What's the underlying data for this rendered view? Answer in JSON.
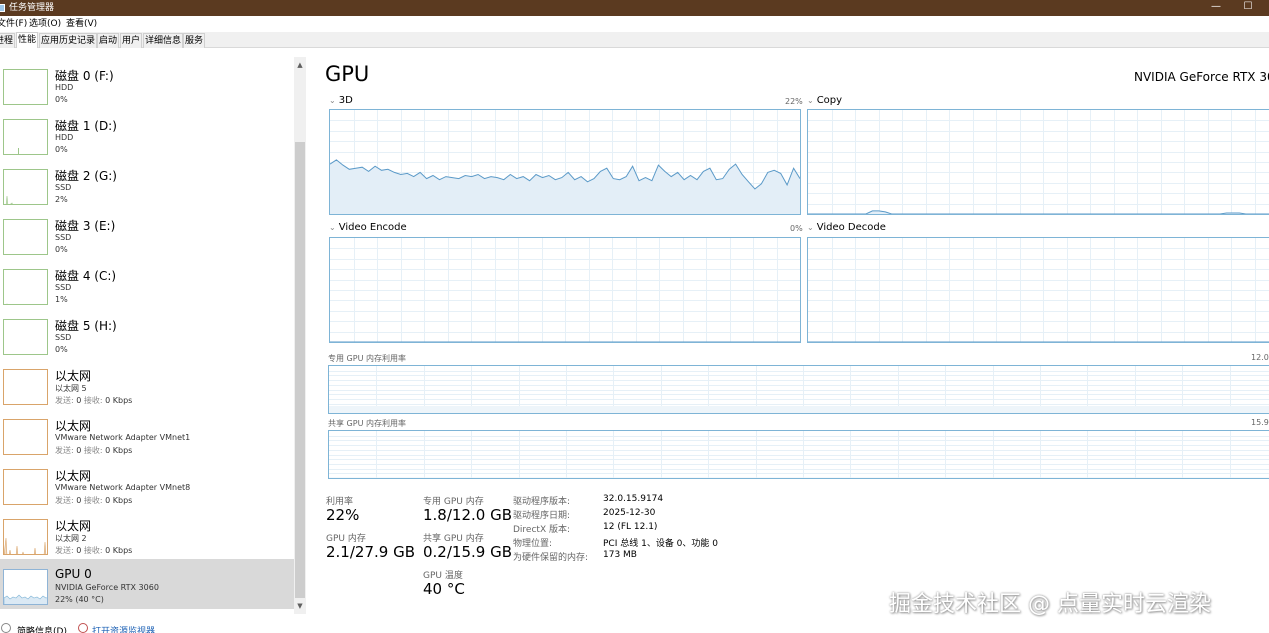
{
  "window": {
    "title": "任务管理器",
    "minimize_glyph": "—",
    "maximize_glyph": "☐"
  },
  "menu": [
    "文件(F)",
    "选项(O)",
    "查看(V)"
  ],
  "tabs": [
    "进程",
    "性能",
    "应用历史记录",
    "启动",
    "用户",
    "详细信息",
    "服务"
  ],
  "active_tab": "性能",
  "sidebar": {
    "items": [
      {
        "name": "磁盘 0 (F:)",
        "sub": "HDD",
        "value": "0%",
        "kind": "disk"
      },
      {
        "name": "磁盘 1 (D:)",
        "sub": "HDD",
        "value": "0%",
        "kind": "disk"
      },
      {
        "name": "磁盘 2 (G:)",
        "sub": "SSD",
        "value": "2%",
        "kind": "disk"
      },
      {
        "name": "磁盘 3 (E:)",
        "sub": "SSD",
        "value": "0%",
        "kind": "disk"
      },
      {
        "name": "磁盘 4 (C:)",
        "sub": "SSD",
        "value": "1%",
        "kind": "disk"
      },
      {
        "name": "磁盘 5 (H:)",
        "sub": "SSD",
        "value": "0%",
        "kind": "disk"
      },
      {
        "name": "以太网",
        "sub": "以太网 5",
        "send_label": "发送:",
        "send": "0",
        "recv_label": "接收:",
        "recv": "0 Kbps",
        "kind": "net"
      },
      {
        "name": "以太网",
        "sub": "VMware Network Adapter VMnet1",
        "send_label": "发送:",
        "send": "0",
        "recv_label": "接收:",
        "recv": "0 Kbps",
        "kind": "net"
      },
      {
        "name": "以太网",
        "sub": "VMware Network Adapter VMnet8",
        "send_label": "发送:",
        "send": "0",
        "recv_label": "接收:",
        "recv": "0 Kbps",
        "kind": "net"
      },
      {
        "name": "以太网",
        "sub": "以太网 2",
        "send_label": "发送:",
        "send": "0",
        "recv_label": "接收:",
        "recv": "0 Kbps",
        "kind": "net"
      },
      {
        "name": "GPU 0",
        "sub": "NVIDIA GeForce RTX 3060",
        "value": "22% (40 °C)",
        "kind": "gpu",
        "selected": true
      }
    ]
  },
  "main": {
    "title": "GPU",
    "gpu_name": "NVIDIA GeForce RTX 30",
    "engines": [
      {
        "label": "3D",
        "pct": "22%"
      },
      {
        "label": "Copy",
        "pct": ""
      },
      {
        "label": "Video Encode",
        "pct": "0%"
      },
      {
        "label": "Video Decode",
        "pct": ""
      }
    ],
    "dedicated_mem_label": "专用 GPU 内存利用率",
    "dedicated_mem_max": "12.0",
    "shared_mem_label": "共享 GPU 内存利用率",
    "shared_mem_max": "15.9",
    "stats": {
      "utilization_label": "利用率",
      "utilization": "22%",
      "dedicated_label": "专用 GPU 内存",
      "dedicated": "1.8/12.0 GB",
      "gpu_mem_label": "GPU 内存",
      "gpu_mem": "2.1/27.9 GB",
      "shared_label": "共享 GPU 内存",
      "shared": "0.2/15.9 GB",
      "temp_label": "GPU 温度",
      "temp": "40 °C"
    },
    "info": [
      {
        "key": "驱动程序版本:",
        "value": "32.0.15.9174"
      },
      {
        "key": "驱动程序日期:",
        "value": "2025-12-30"
      },
      {
        "key": "DirectX 版本:",
        "value": "12 (FL 12.1)"
      },
      {
        "key": "物理位置:",
        "value": "PCI 总线 1、设备 0、功能 0"
      },
      {
        "key": "为硬件保留的内存:",
        "value": "173 MB"
      }
    ]
  },
  "footer": {
    "fewer_details": "简略信息(D)",
    "open_monitor": "打开资源监视器"
  },
  "watermark": "掘金技术社区 @ 点量实时云渲染",
  "colors": {
    "disk_accent": "#9dc68a",
    "net_accent": "#d9a46a",
    "gpu_accent": "#7eb4d6",
    "titlebar": "#5b3a20"
  },
  "chart_data": {
    "type": "area",
    "series": [
      {
        "name": "3D",
        "values": [
          48,
          52,
          47,
          43,
          44,
          45,
          41,
          46,
          42,
          43,
          40,
          38,
          39,
          36,
          40,
          34,
          37,
          33,
          36,
          35,
          34,
          37,
          36,
          38,
          34,
          36,
          35,
          33,
          38,
          34,
          36,
          32,
          38,
          35,
          37,
          33,
          35,
          40,
          33,
          36,
          31,
          34,
          41,
          44,
          34,
          33,
          36,
          46,
          32,
          35,
          32,
          47,
          41,
          36,
          40,
          33,
          37,
          33,
          41,
          44,
          33,
          34,
          43,
          48,
          38,
          31,
          24,
          29,
          40,
          42,
          39,
          28,
          44,
          34
        ]
      },
      {
        "name": "Copy",
        "values": [
          0,
          0,
          0,
          0,
          0,
          0,
          0,
          0,
          0,
          0,
          3,
          3,
          2,
          0,
          0,
          0,
          0,
          0,
          0,
          0,
          0,
          0,
          0,
          0,
          0,
          0,
          0,
          0,
          0,
          0,
          0,
          0,
          0,
          0,
          0,
          0,
          0,
          0,
          0,
          0,
          0,
          0,
          0,
          0,
          0,
          0,
          0,
          0,
          0,
          0,
          0,
          0,
          0,
          0,
          0,
          0,
          0,
          0,
          0,
          0,
          0,
          0,
          0,
          0,
          0,
          1,
          1,
          1,
          0,
          0,
          0,
          0,
          0,
          0
        ]
      },
      {
        "name": "Video Encode",
        "values": [
          0,
          0,
          0,
          0,
          0,
          0,
          0,
          0,
          0,
          0
        ]
      },
      {
        "name": "Video Decode",
        "values": [
          0,
          0,
          0,
          0,
          0,
          0,
          0,
          0,
          0,
          0
        ]
      }
    ],
    "ylim": [
      0,
      100
    ],
    "grid": true
  }
}
